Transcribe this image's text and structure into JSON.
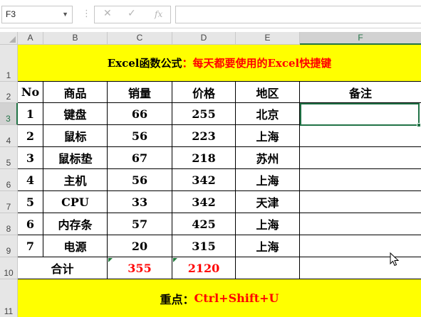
{
  "formula_bar": {
    "name_box": "F3",
    "formula": ""
  },
  "columns": [
    "A",
    "B",
    "C",
    "D",
    "E",
    "F"
  ],
  "selected_column": "F",
  "rows": [
    "1",
    "2",
    "3",
    "4",
    "5",
    "6",
    "7",
    "8",
    "9",
    "10",
    "11"
  ],
  "selected_row": "3",
  "sheet": {
    "title_black_1": "Excel函数公式",
    "title_red": "：每天都要使用的Excel快捷键",
    "headers": [
      "No",
      "商品",
      "销量",
      "价格",
      "地区",
      "备注"
    ],
    "data": [
      [
        "1",
        "键盘",
        "66",
        "255",
        "北京",
        ""
      ],
      [
        "2",
        "鼠标",
        "56",
        "223",
        "上海",
        ""
      ],
      [
        "3",
        "鼠标垫",
        "67",
        "218",
        "苏州",
        ""
      ],
      [
        "4",
        "主机",
        "56",
        "342",
        "上海",
        ""
      ],
      [
        "5",
        "CPU",
        "33",
        "342",
        "天津",
        ""
      ],
      [
        "6",
        "内存条",
        "57",
        "425",
        "上海",
        ""
      ],
      [
        "7",
        "电源",
        "20",
        "315",
        "上海",
        ""
      ]
    ],
    "total_label": "合计",
    "total_sales": "355",
    "total_price": "2120",
    "note_label": "重点：",
    "note_shortcut": "Ctrl+Shift+U"
  },
  "colors": {
    "highlight": "#ffff00",
    "accent_red": "#ff0000",
    "selection": "#217346"
  }
}
